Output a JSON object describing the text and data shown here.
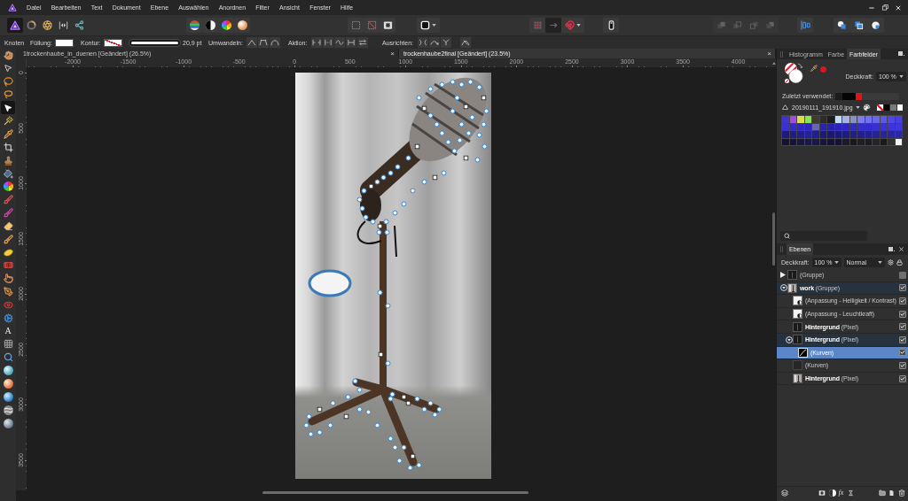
{
  "menu_bar": {
    "items": [
      "Datei",
      "Bearbeiten",
      "Text",
      "Dokument",
      "Ebene",
      "Auswählen",
      "Anordnen",
      "Filter",
      "Ansicht",
      "Fenster",
      "Hilfe"
    ]
  },
  "toolbar": {
    "personas": [
      {
        "kind": "photo",
        "selected": true
      },
      {
        "kind": "liquify",
        "selected": false
      },
      {
        "kind": "develop",
        "selected": false
      },
      {
        "kind": "tonemap",
        "selected": false
      },
      {
        "kind": "export",
        "selected": false
      }
    ],
    "arrange": [
      {
        "kind": "front",
        "disabled": true
      },
      {
        "kind": "forward",
        "disabled": true
      },
      {
        "kind": "backward",
        "disabled": true
      },
      {
        "kind": "back",
        "disabled": true
      }
    ]
  },
  "context_toolbar": {
    "tool": "Knoten",
    "fill_label": "Füllung:",
    "stroke_label": "Kontur:",
    "stroke_width": {
      "level": 1,
      "reading": "20,9 pt"
    },
    "convert_label": "Umwandeln:",
    "action_label": "Aktion:",
    "align_label": "Ausrichten:"
  },
  "tools": [
    {
      "kind": "hand",
      "selected": false
    },
    {
      "kind": "move",
      "selected": false
    },
    {
      "kind": "lasso",
      "selected": false
    },
    {
      "kind": "loop",
      "selected": false
    },
    {
      "kind": "node",
      "selected": true
    },
    {
      "kind": "wand",
      "selected": false
    },
    {
      "kind": "picker",
      "selected": false
    },
    {
      "kind": "crop",
      "selected": false
    },
    {
      "kind": "clone",
      "selected": false
    },
    {
      "kind": "fill",
      "selected": false
    },
    {
      "kind": "gradient",
      "selected": false
    },
    {
      "kind": "paint",
      "selected": false
    },
    {
      "kind": "recolor",
      "selected": false
    },
    {
      "kind": "erase",
      "selected": false
    },
    {
      "kind": "dodge",
      "selected": false
    },
    {
      "kind": "sponge",
      "selected": false
    },
    {
      "kind": "heal",
      "selected": false
    },
    {
      "kind": "smudge",
      "selected": false
    },
    {
      "kind": "pen",
      "selected": false
    },
    {
      "kind": "redeye",
      "selected": false
    },
    {
      "kind": "shape",
      "selected": false
    },
    {
      "kind": "text",
      "label": "A",
      "selected": false
    },
    {
      "kind": "mesh",
      "selected": false
    },
    {
      "kind": "zoom",
      "selected": false
    },
    {
      "kind": "aqua",
      "selected": false
    },
    {
      "kind": "amber",
      "selected": false
    },
    {
      "kind": "azure",
      "selected": false
    },
    {
      "kind": "swirl",
      "selected": false
    },
    {
      "kind": "steel",
      "selected": false
    }
  ],
  "document_tabs": [
    {
      "title": "1trockenhaube_in_duenen [Geändert] (26.5%)",
      "close": "×",
      "selected": false
    },
    {
      "title": "trockenhaube2final [Geändert] (23.5%)",
      "close": "×",
      "selected": true
    }
  ],
  "rulers": {
    "horizontal": [
      "-2000",
      "-1500",
      "-1000",
      "-500",
      "0",
      "500",
      "1000",
      "1500",
      "2000",
      "2500",
      "3000",
      "3500",
      "4000"
    ],
    "vertical": [
      "0",
      "500",
      "1000",
      "1500",
      "2000",
      "2500",
      "3000",
      "3500"
    ]
  },
  "swatches_panel": {
    "tabs": [
      {
        "label": "Histogramm",
        "selected": false
      },
      {
        "label": "Farbe",
        "selected": false
      },
      {
        "label": "Farbfelder",
        "selected": true
      }
    ],
    "opacity_label": "Deckkraft:",
    "opacity_value": "100 %",
    "recent_label": "Zuletzt verwendet:",
    "recent": [
      {
        "color": "#1c1c1c"
      },
      {
        "color": "#050505"
      },
      {
        "color": "#050505"
      },
      {
        "color": "#e01414"
      }
    ],
    "palette_name": "20190111_191910.jpg",
    "quick": [
      {
        "kind": "none"
      },
      {
        "kind": "color",
        "color": "#000000"
      },
      {
        "kind": "color",
        "color": "#7a7a7a"
      },
      {
        "kind": "color",
        "color": "#ffffff"
      }
    ],
    "grid": [
      {
        "color": "#3d36c9"
      },
      {
        "color": "#a64be0"
      },
      {
        "color": "#d8e046"
      },
      {
        "color": "#8ee05c"
      },
      {
        "color": "#3e3a2e"
      },
      {
        "color": "#2e2a26"
      },
      {
        "color": "#1c1c1e"
      },
      {
        "color": "#c2dcf2"
      },
      {
        "color": "#a4b0e6"
      },
      {
        "color": "#8890c4"
      },
      {
        "color": "#7c7cf0"
      },
      {
        "color": "#7272f0"
      },
      {
        "color": "#6a66ee"
      },
      {
        "color": "#5e58ea"
      },
      {
        "color": "#5048e4"
      },
      {
        "color": "#4a3ee0"
      },
      {
        "color": "#3a30d8"
      },
      {
        "color": "#3428d0"
      },
      {
        "color": "#3026c8"
      },
      {
        "color": "#2c24c0"
      },
      {
        "color": "#6a66b0"
      },
      {
        "color": "#2a22b8"
      },
      {
        "color": "#2820b0"
      },
      {
        "color": "#2a22ba"
      },
      {
        "color": "#2e26c4"
      },
      {
        "color": "#3028c8"
      },
      {
        "color": "#342ccc"
      },
      {
        "color": "#342ad0"
      },
      {
        "color": "#3630d4"
      },
      {
        "color": "#3a32d8"
      },
      {
        "color": "#3c34dc"
      },
      {
        "color": "#3e36de"
      },
      {
        "color": "#1e1a80"
      },
      {
        "color": "#201c88"
      },
      {
        "color": "#221e90"
      },
      {
        "color": "#242098"
      },
      {
        "color": "#20208a"
      },
      {
        "color": "#1c1a7a"
      },
      {
        "color": "#1a1870"
      },
      {
        "color": "#1c1a76"
      },
      {
        "color": "#1e1c80"
      },
      {
        "color": "#201e88"
      },
      {
        "color": "#22208e"
      },
      {
        "color": "#242094"
      },
      {
        "color": "#262298"
      },
      {
        "color": "#28249c"
      },
      {
        "color": "#2a26a0"
      },
      {
        "color": "#2c28a4"
      },
      {
        "color": "#141238"
      },
      {
        "color": "#16143e"
      },
      {
        "color": "#181644"
      },
      {
        "color": "#1a1848"
      },
      {
        "color": "#1a184a"
      },
      {
        "color": "#161442"
      },
      {
        "color": "#14123a"
      },
      {
        "color": "#141236"
      },
      {
        "color": "#1a1a2a"
      },
      {
        "color": "#18181e"
      },
      {
        "color": "#1e1e24"
      },
      {
        "color": "#1c1c20"
      },
      {
        "color": "#24242a"
      },
      {
        "color": "#1a1a1c"
      },
      {
        "color": "#303030"
      },
      {
        "color": "#f4f4f4"
      }
    ]
  },
  "layers_panel": {
    "tab": "Ebenen",
    "opacity_label": "Deckkraft:",
    "opacity_value": "100 %",
    "blend_mode": "Normal",
    "layers": [
      {
        "name": "(Gruppe)",
        "kind": "dark",
        "expanded": false,
        "selected": false,
        "visible": false
      },
      {
        "name": "**work** (Gruppe)",
        "kind": "photo",
        "expanded": true,
        "selected": false,
        "visible": true,
        "children": [
          {
            "name": "(Anpassung - Helligkeit / Kontrast)",
            "kind": "adjustment",
            "selected": false,
            "visible": true
          },
          {
            "name": "(Anpassung - Leuchtkraft)",
            "kind": "adjustment",
            "selected": false,
            "visible": true
          },
          {
            "name": "**Hintergrund** (Pixel)",
            "kind": "dark",
            "selected": false,
            "visible": true
          },
          {
            "name": "**Hintergrund** (Pixel)",
            "kind": "dark",
            "expanded": true,
            "selected": false,
            "visible": true,
            "children": [
              {
                "name": "(Kurven)",
                "kind": "curve",
                "selected": true,
                "visible": true
              }
            ]
          },
          {
            "name": "(Kurven)",
            "kind": "blank",
            "selected": false,
            "visible": true
          },
          {
            "name": "**Hintergrund** (Pixel)",
            "kind": "photo",
            "selected": false,
            "visible": true
          }
        ]
      }
    ],
    "effects_label": "fx"
  }
}
